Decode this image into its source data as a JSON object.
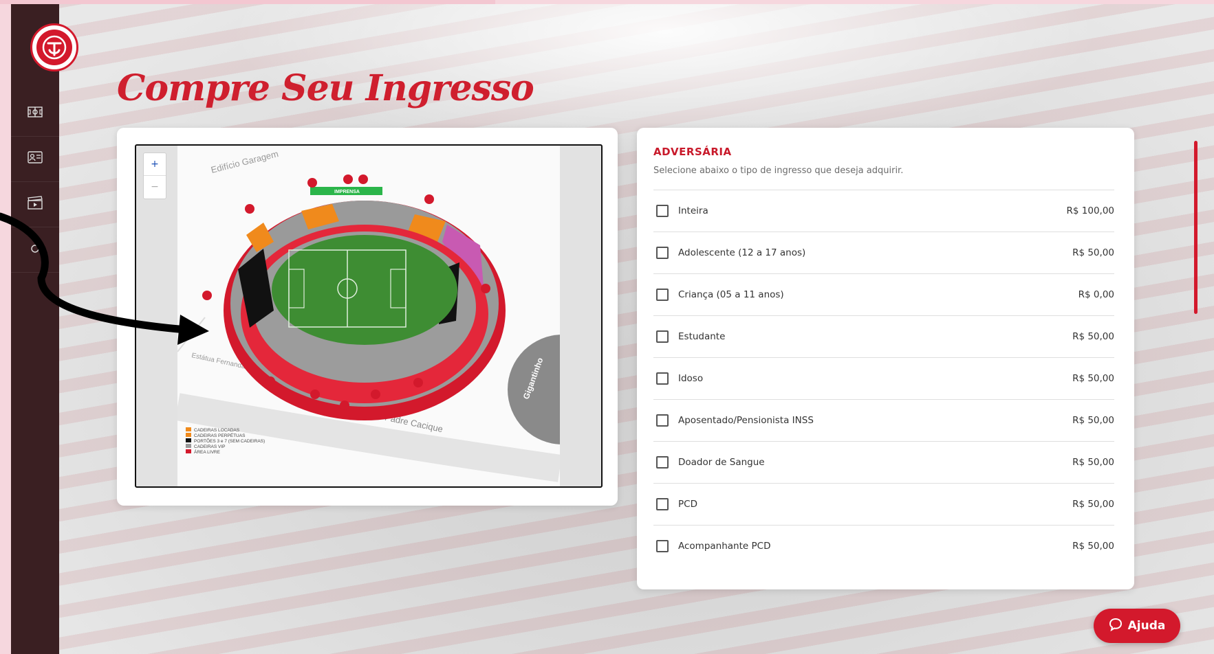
{
  "page": {
    "title": "Compre Seu Ingresso"
  },
  "brand": {
    "primary_color": "#d3192c",
    "sidebar_color": "#3a1f22"
  },
  "sidebar": {
    "items": [
      {
        "icon": "field-icon"
      },
      {
        "icon": "id-card-icon"
      },
      {
        "icon": "clapper-icon"
      }
    ]
  },
  "map": {
    "zoom_in": "+",
    "zoom_out": "−",
    "labels": {
      "building": "Edifício Garagem",
      "press": "IMPRENSA",
      "statue": "Estátua Fernandão",
      "street": "Av. Padre Cacique",
      "gigantinho": "Gigantinho"
    },
    "legend": [
      {
        "label": "CADEIRAS LOCADAS",
        "color": "#f08a1c"
      },
      {
        "label": "CADEIRAS PERPÉTUAS",
        "color": "#f08a1c"
      },
      {
        "label": "PORTÕES 3 e 7 (SEM CADEIRAS)",
        "color": "#111111"
      },
      {
        "label": "CADEIRAS VIP",
        "color": "#999999"
      },
      {
        "label": "ÁREA LIVRE",
        "color": "#d3192c"
      }
    ]
  },
  "tickets": {
    "section_title": "ADVERSÁRIA",
    "subtitle": "Selecione abaixo o tipo de ingresso que deseja adquirir.",
    "items": [
      {
        "label": "Inteira",
        "price": "R$ 100,00"
      },
      {
        "label": "Adolescente (12 a 17 anos)",
        "price": "R$ 50,00"
      },
      {
        "label": "Criança (05 a 11 anos)",
        "price": "R$ 0,00"
      },
      {
        "label": "Estudante",
        "price": "R$ 50,00"
      },
      {
        "label": "Idoso",
        "price": "R$ 50,00"
      },
      {
        "label": "Aposentado/Pensionista INSS",
        "price": "R$ 50,00"
      },
      {
        "label": "Doador de Sangue",
        "price": "R$ 50,00"
      },
      {
        "label": "PCD",
        "price": "R$ 50,00"
      },
      {
        "label": "Acompanhante PCD",
        "price": "R$ 50,00"
      }
    ]
  },
  "help": {
    "label": "Ajuda"
  }
}
